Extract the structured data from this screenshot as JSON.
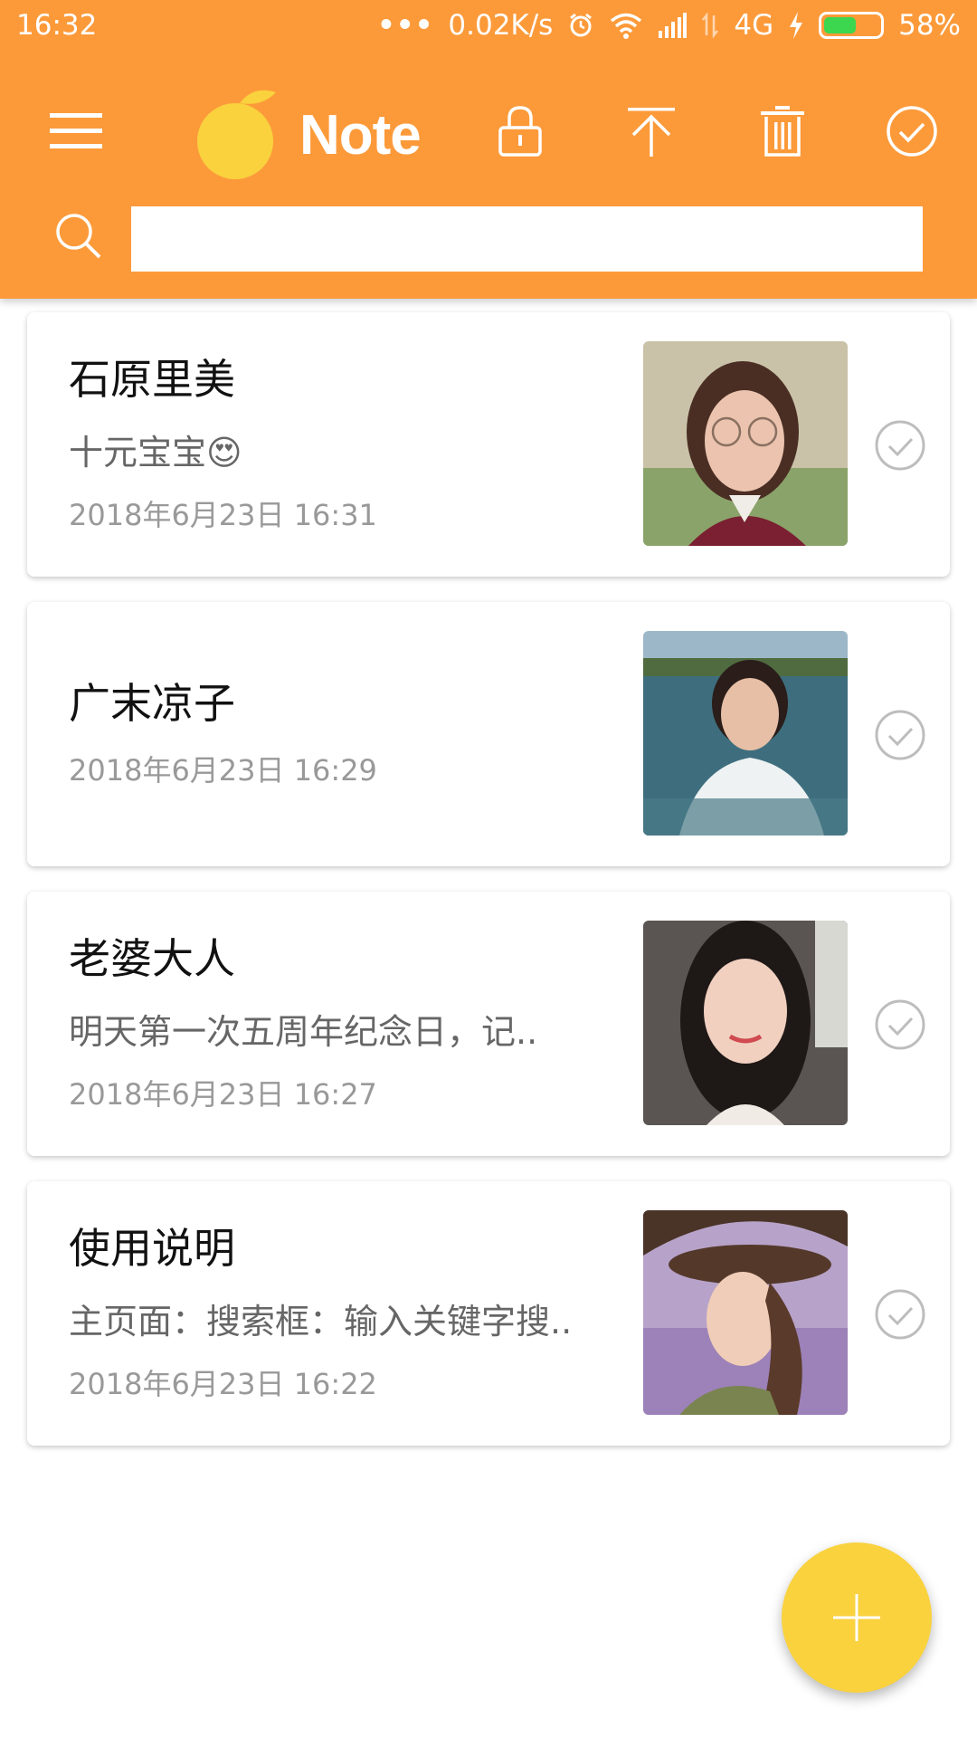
{
  "status_bar": {
    "time": "16:32",
    "network_speed": "0.02K/s",
    "network_type": "4G",
    "battery_percent": "58%",
    "battery_level": 0.58
  },
  "app": {
    "title": "Note",
    "accent_color": "#FC9A3A",
    "fab_color": "#F9D23E"
  },
  "search": {
    "value": "",
    "placeholder": ""
  },
  "notes": [
    {
      "title": "石原里美",
      "preview": "十元宝宝😍",
      "date": "2018年6月23日  16:31"
    },
    {
      "title": "广末凉子",
      "preview": "",
      "date": "2018年6月23日  16:29"
    },
    {
      "title": "老婆大人",
      "preview": "明天第一次五周年纪念日，记..",
      "date": "2018年6月23日  16:27"
    },
    {
      "title": "使用说明",
      "preview": "主页面：搜索框：输入关键字搜..",
      "date": "2018年6月23日  16:22"
    }
  ]
}
